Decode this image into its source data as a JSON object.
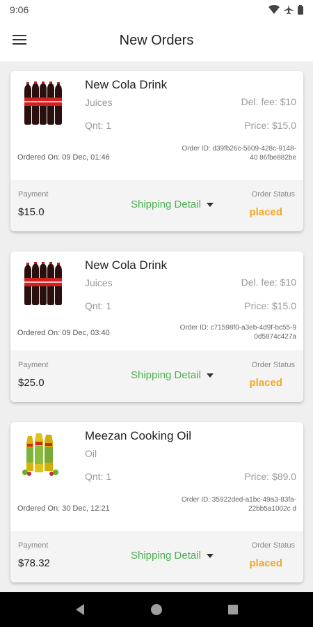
{
  "status": {
    "time": "9:06"
  },
  "header": {
    "title": "New Orders"
  },
  "orders": [
    {
      "name": "New Cola Drink",
      "category": "Juices",
      "quantity": "Qnt: 1",
      "delivery_fee": "Del. fee: $10",
      "price": "Price: $15.0",
      "ordered_on": "Ordered On: 09 Dec, 01:46",
      "order_id": "Order ID: d39fb26c-5609-428c-9148-40 86fbe882be",
      "payment_label": "Payment",
      "payment": "$15.0",
      "shipping_label": "Shipping Detail",
      "status_label": "Order Status",
      "status": "placed"
    },
    {
      "name": "New Cola Drink",
      "category": "Juices",
      "quantity": "Qnt: 1",
      "delivery_fee": "Del. fee: $10",
      "price": "Price: $15.0",
      "ordered_on": "Ordered On: 09 Dec, 03:40",
      "order_id": "Order ID: c71598f0-a3eb-4d9f-bc55-90d5874c427a",
      "payment_label": "Payment",
      "payment": "$25.0",
      "shipping_label": "Shipping Detail",
      "status_label": "Order Status",
      "status": "placed"
    },
    {
      "name": "Meezan Cooking Oil",
      "category": "Oil",
      "quantity": "Qnt: 1",
      "price": "Price: $89.0",
      "ordered_on": "Ordered On: 30 Dec, 12:21",
      "order_id": "Order ID: 35922ded-a1bc-49a3-83fa-22bb5a1002c d",
      "payment_label": "Payment",
      "payment": "$78.32",
      "shipping_label": "Shipping Detail",
      "status_label": "Order Status",
      "status": "placed"
    }
  ],
  "colors": {
    "shipping": "#4caf50",
    "status": "#f5a623"
  },
  "icons": {
    "menu": "hamburger-icon",
    "back": "back-icon",
    "home": "home-icon",
    "recents": "recents-icon"
  }
}
